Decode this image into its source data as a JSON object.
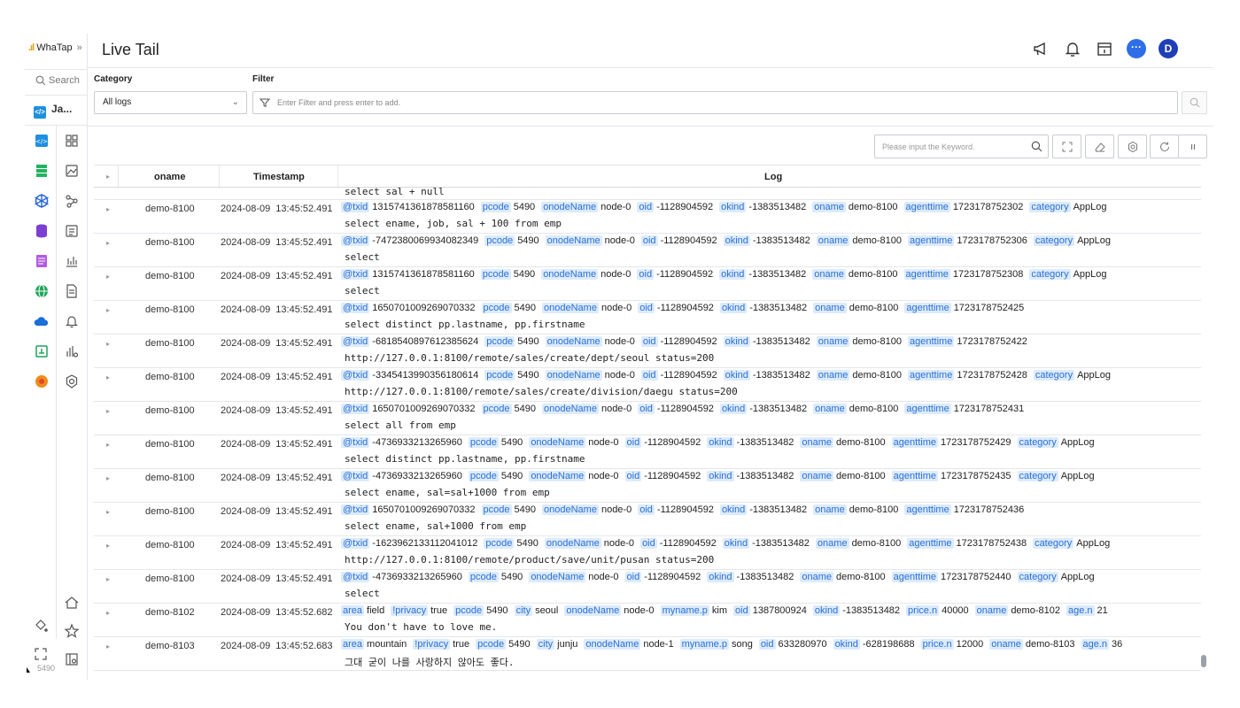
{
  "app": {
    "brand": "WhaTap",
    "page_title": "Live Tail",
    "version": "5490"
  },
  "sidebar": {
    "search_label": "Search",
    "project_label": "Ja..."
  },
  "header": {
    "avatar_initial": "D"
  },
  "filter": {
    "category_label": "Category",
    "filter_label": "Filter",
    "category_value": "All logs",
    "filter_placeholder": "Enter Filter and press enter to add."
  },
  "toolbar": {
    "keyword_placeholder": "Please input the Keyword."
  },
  "table": {
    "columns": [
      "oname",
      "Timestamp",
      "Log"
    ],
    "cutoff_line": "select sal + null",
    "rows": [
      {
        "oname": "demo-8100",
        "date": "2024-08-09",
        "time": "13:45:52.491",
        "fields": [
          {
            "k": "@txid",
            "v": "1315741361878581160"
          },
          {
            "k": "pcode",
            "v": "5490"
          },
          {
            "k": "onodeName",
            "v": "node-0"
          },
          {
            "k": "oid",
            "v": "-1128904592"
          },
          {
            "k": "okind",
            "v": "-1383513482"
          },
          {
            "k": "oname",
            "v": "demo-8100"
          },
          {
            "k": "agenttime",
            "v": "1723178752302"
          },
          {
            "k": "category",
            "v": "AppLog"
          }
        ],
        "message": "select ename, job, sal + 100 from emp"
      },
      {
        "oname": "demo-8100",
        "date": "2024-08-09",
        "time": "13:45:52.491",
        "fields": [
          {
            "k": "@txid",
            "v": "-7472380069934082349"
          },
          {
            "k": "pcode",
            "v": "5490"
          },
          {
            "k": "onodeName",
            "v": "node-0"
          },
          {
            "k": "oid",
            "v": "-1128904592"
          },
          {
            "k": "okind",
            "v": "-1383513482"
          },
          {
            "k": "oname",
            "v": "demo-8100"
          },
          {
            "k": "agenttime",
            "v": "1723178752306"
          },
          {
            "k": "category",
            "v": "AppLog"
          }
        ],
        "message": "select"
      },
      {
        "oname": "demo-8100",
        "date": "2024-08-09",
        "time": "13:45:52.491",
        "fields": [
          {
            "k": "@txid",
            "v": "1315741361878581160"
          },
          {
            "k": "pcode",
            "v": "5490"
          },
          {
            "k": "onodeName",
            "v": "node-0"
          },
          {
            "k": "oid",
            "v": "-1128904592"
          },
          {
            "k": "okind",
            "v": "-1383513482"
          },
          {
            "k": "oname",
            "v": "demo-8100"
          },
          {
            "k": "agenttime",
            "v": "1723178752308"
          },
          {
            "k": "category",
            "v": "AppLog"
          }
        ],
        "message": "select"
      },
      {
        "oname": "demo-8100",
        "date": "2024-08-09",
        "time": "13:45:52.491",
        "fields": [
          {
            "k": "@txid",
            "v": "1650701009269070332"
          },
          {
            "k": "pcode",
            "v": "5490"
          },
          {
            "k": "onodeName",
            "v": "node-0"
          },
          {
            "k": "oid",
            "v": "-1128904592"
          },
          {
            "k": "okind",
            "v": "-1383513482"
          },
          {
            "k": "oname",
            "v": "demo-8100"
          },
          {
            "k": "agenttime",
            "v": "1723178752425"
          }
        ],
        "message": "select distinct pp.lastname, pp.firstname"
      },
      {
        "oname": "demo-8100",
        "date": "2024-08-09",
        "time": "13:45:52.491",
        "fields": [
          {
            "k": "@txid",
            "v": "-6818540897612385624"
          },
          {
            "k": "pcode",
            "v": "5490"
          },
          {
            "k": "onodeName",
            "v": "node-0"
          },
          {
            "k": "oid",
            "v": "-1128904592"
          },
          {
            "k": "okind",
            "v": "-1383513482"
          },
          {
            "k": "oname",
            "v": "demo-8100"
          },
          {
            "k": "agenttime",
            "v": "1723178752422"
          }
        ],
        "message": "http://127.0.0.1:8100/remote/sales/create/dept/seoul status=200"
      },
      {
        "oname": "demo-8100",
        "date": "2024-08-09",
        "time": "13:45:52.491",
        "fields": [
          {
            "k": "@txid",
            "v": "-3345413990356180614"
          },
          {
            "k": "pcode",
            "v": "5490"
          },
          {
            "k": "onodeName",
            "v": "node-0"
          },
          {
            "k": "oid",
            "v": "-1128904592"
          },
          {
            "k": "okind",
            "v": "-1383513482"
          },
          {
            "k": "oname",
            "v": "demo-8100"
          },
          {
            "k": "agenttime",
            "v": "1723178752428"
          },
          {
            "k": "category",
            "v": "AppLog"
          }
        ],
        "message": "http://127.0.0.1:8100/remote/sales/create/division/daegu status=200"
      },
      {
        "oname": "demo-8100",
        "date": "2024-08-09",
        "time": "13:45:52.491",
        "fields": [
          {
            "k": "@txid",
            "v": "1650701009269070332"
          },
          {
            "k": "pcode",
            "v": "5490"
          },
          {
            "k": "onodeName",
            "v": "node-0"
          },
          {
            "k": "oid",
            "v": "-1128904592"
          },
          {
            "k": "okind",
            "v": "-1383513482"
          },
          {
            "k": "oname",
            "v": "demo-8100"
          },
          {
            "k": "agenttime",
            "v": "1723178752431"
          }
        ],
        "message": "select all from emp"
      },
      {
        "oname": "demo-8100",
        "date": "2024-08-09",
        "time": "13:45:52.491",
        "fields": [
          {
            "k": "@txid",
            "v": "-4736933213265960"
          },
          {
            "k": "pcode",
            "v": "5490"
          },
          {
            "k": "onodeName",
            "v": "node-0"
          },
          {
            "k": "oid",
            "v": "-1128904592"
          },
          {
            "k": "okind",
            "v": "-1383513482"
          },
          {
            "k": "oname",
            "v": "demo-8100"
          },
          {
            "k": "agenttime",
            "v": "1723178752429"
          },
          {
            "k": "category",
            "v": "AppLog"
          }
        ],
        "message": "select distinct pp.lastname, pp.firstname"
      },
      {
        "oname": "demo-8100",
        "date": "2024-08-09",
        "time": "13:45:52.491",
        "fields": [
          {
            "k": "@txid",
            "v": "-4736933213265960"
          },
          {
            "k": "pcode",
            "v": "5490"
          },
          {
            "k": "onodeName",
            "v": "node-0"
          },
          {
            "k": "oid",
            "v": "-1128904592"
          },
          {
            "k": "okind",
            "v": "-1383513482"
          },
          {
            "k": "oname",
            "v": "demo-8100"
          },
          {
            "k": "agenttime",
            "v": "1723178752435"
          },
          {
            "k": "category",
            "v": "AppLog"
          }
        ],
        "message": "select ename, sal=sal+1000 from emp"
      },
      {
        "oname": "demo-8100",
        "date": "2024-08-09",
        "time": "13:45:52.491",
        "fields": [
          {
            "k": "@txid",
            "v": "1650701009269070332"
          },
          {
            "k": "pcode",
            "v": "5490"
          },
          {
            "k": "onodeName",
            "v": "node-0"
          },
          {
            "k": "oid",
            "v": "-1128904592"
          },
          {
            "k": "okind",
            "v": "-1383513482"
          },
          {
            "k": "oname",
            "v": "demo-8100"
          },
          {
            "k": "agenttime",
            "v": "1723178752436"
          }
        ],
        "message": "select ename, sal+1000 from emp"
      },
      {
        "oname": "demo-8100",
        "date": "2024-08-09",
        "time": "13:45:52.491",
        "fields": [
          {
            "k": "@txid",
            "v": "-1623962133112041012"
          },
          {
            "k": "pcode",
            "v": "5490"
          },
          {
            "k": "onodeName",
            "v": "node-0"
          },
          {
            "k": "oid",
            "v": "-1128904592"
          },
          {
            "k": "okind",
            "v": "-1383513482"
          },
          {
            "k": "oname",
            "v": "demo-8100"
          },
          {
            "k": "agenttime",
            "v": "1723178752438"
          },
          {
            "k": "category",
            "v": "AppLog"
          }
        ],
        "message": "http://127.0.0.1:8100/remote/product/save/unit/pusan status=200"
      },
      {
        "oname": "demo-8100",
        "date": "2024-08-09",
        "time": "13:45:52.491",
        "fields": [
          {
            "k": "@txid",
            "v": "-4736933213265960"
          },
          {
            "k": "pcode",
            "v": "5490"
          },
          {
            "k": "onodeName",
            "v": "node-0"
          },
          {
            "k": "oid",
            "v": "-1128904592"
          },
          {
            "k": "okind",
            "v": "-1383513482"
          },
          {
            "k": "oname",
            "v": "demo-8100"
          },
          {
            "k": "agenttime",
            "v": "1723178752440"
          },
          {
            "k": "category",
            "v": "AppLog"
          }
        ],
        "message": "select"
      },
      {
        "oname": "demo-8102",
        "date": "2024-08-09",
        "time": "13:45:52.682",
        "fields": [
          {
            "k": "area",
            "v": "field"
          },
          {
            "k": "!privacy",
            "v": "true"
          },
          {
            "k": "pcode",
            "v": "5490"
          },
          {
            "k": "city",
            "v": "seoul"
          },
          {
            "k": "onodeName",
            "v": "node-0"
          },
          {
            "k": "myname.p",
            "v": "kim"
          },
          {
            "k": "oid",
            "v": "1387800924"
          },
          {
            "k": "okind",
            "v": "-1383513482"
          },
          {
            "k": "price.n",
            "v": "40000"
          },
          {
            "k": "oname",
            "v": "demo-8102"
          },
          {
            "k": "age.n",
            "v": "21"
          }
        ],
        "message": "You don't have to love me."
      },
      {
        "oname": "demo-8103",
        "date": "2024-08-09",
        "time": "13:45:52.683",
        "fields": [
          {
            "k": "area",
            "v": "mountain"
          },
          {
            "k": "!privacy",
            "v": "true"
          },
          {
            "k": "pcode",
            "v": "5490"
          },
          {
            "k": "city",
            "v": "junju"
          },
          {
            "k": "onodeName",
            "v": "node-1"
          },
          {
            "k": "myname.p",
            "v": "song"
          },
          {
            "k": "oid",
            "v": "633280970"
          },
          {
            "k": "okind",
            "v": "-628198688"
          },
          {
            "k": "price.n",
            "v": "12000"
          },
          {
            "k": "oname",
            "v": "demo-8103"
          },
          {
            "k": "age.n",
            "v": "36"
          }
        ],
        "message": "그대 굳이 나를 사랑하지 않아도 좋다."
      }
    ]
  }
}
